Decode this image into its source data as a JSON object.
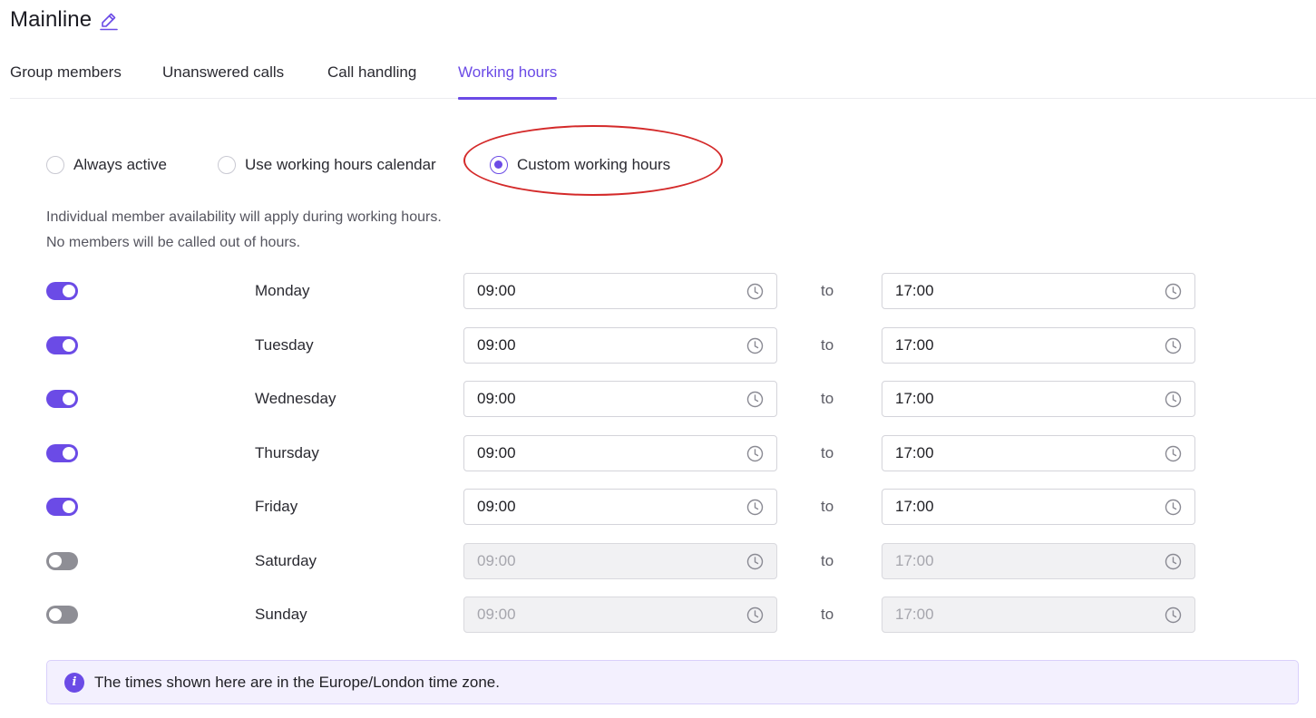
{
  "page": {
    "title": "Mainline"
  },
  "tabs": [
    {
      "label": "Group members",
      "active": false
    },
    {
      "label": "Unanswered calls",
      "active": false
    },
    {
      "label": "Call handling",
      "active": false
    },
    {
      "label": "Working hours",
      "active": true
    }
  ],
  "mode_options": [
    {
      "label": "Always active",
      "checked": false
    },
    {
      "label": "Use working hours calendar",
      "checked": false
    },
    {
      "label": "Custom working hours",
      "checked": true
    }
  ],
  "info": {
    "line1": "Individual member availability will apply during working hours.",
    "line2": "No members will be called out of hours."
  },
  "separator_label": "to",
  "days": [
    {
      "name": "Monday",
      "enabled": true,
      "start": "09:00",
      "end": "17:00"
    },
    {
      "name": "Tuesday",
      "enabled": true,
      "start": "09:00",
      "end": "17:00"
    },
    {
      "name": "Wednesday",
      "enabled": true,
      "start": "09:00",
      "end": "17:00"
    },
    {
      "name": "Thursday",
      "enabled": true,
      "start": "09:00",
      "end": "17:00"
    },
    {
      "name": "Friday",
      "enabled": true,
      "start": "09:00",
      "end": "17:00"
    },
    {
      "name": "Saturday",
      "enabled": false,
      "start": "09:00",
      "end": "17:00"
    },
    {
      "name": "Sunday",
      "enabled": false,
      "start": "09:00",
      "end": "17:00"
    }
  ],
  "timezone_notice": "The times shown here are in the Europe/London time zone.",
  "icons": {
    "title": "pencil-icon",
    "time_field": "clock-icon",
    "notice": "info-icon"
  },
  "colors": {
    "accent": "#6b4be6",
    "annotation": "#d42a2a",
    "toggle_off": "#8e8e95",
    "notice_bg": "#f3f0fe"
  }
}
